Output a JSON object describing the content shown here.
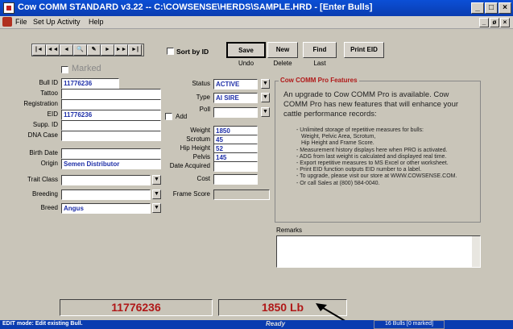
{
  "title": "Cow COMM STANDARD v3.22 -- C:\\COWSENSE\\HERDS\\SAMPLE.HRD - [Enter Bulls]",
  "window_buttons": {
    "minimize": "_",
    "maximize": "□",
    "close": "×"
  },
  "menu": {
    "file": "File",
    "setup": "Set Up",
    "activity": "Activity",
    "help": "Help"
  },
  "mdi_buttons": {
    "minimize": "_",
    "restore": "ø",
    "close": "×"
  },
  "nav": [
    "|◄",
    "◄◄",
    "◄",
    "🔍",
    "✎",
    "►",
    "►►",
    "►|"
  ],
  "sort_by_id": "Sort by ID",
  "buttons": {
    "save": "Save",
    "undo": "Undo",
    "new": "New",
    "delete": "Delete",
    "find": "Find",
    "last": "Last",
    "print_eid": "Print EID"
  },
  "marked": "Marked",
  "labels": {
    "bull_id": "Bull ID",
    "tattoo": "Tattoo",
    "registration": "Registration",
    "eid": "EID",
    "supp_id": "Supp. ID",
    "dna_case": "DNA Case",
    "birth_date": "Birth Date",
    "origin": "Origin",
    "trait_class": "Trait Class",
    "breeding": "Breeding",
    "breed": "Breed",
    "status": "Status",
    "type": "Type",
    "poll": "Poll",
    "add": "Add",
    "weight": "Weight",
    "scrotum": "Scrotum",
    "hip_height": "Hip Height",
    "pelvis": "Pelvis",
    "date_acquired": "Date Acquired",
    "cost": "Cost",
    "frame_score": "Frame Score",
    "remarks": "Remarks"
  },
  "values": {
    "bull_id": "11776236",
    "eid": "11776236",
    "origin": "Semen Distributor",
    "breed": "Angus",
    "status": "ACTIVE",
    "type": "AI SIRE",
    "weight": "1850",
    "scrotum": "45",
    "hip_height": "52",
    "pelvis": "145"
  },
  "pro": {
    "title": "Cow COMM Pro Features",
    "intro": "An upgrade to Cow COMM Pro is available. Cow COMM Pro has new features that will enhance your cattle performance records:",
    "bullets": [
      "- Unlimited storage of repetitive measures for bulls:",
      "  Weight, Pelvic Area, Scrotum,",
      "  Hip Height and Frame Score.",
      "- Measurement history displays here when PRO is activated.",
      "- ADG from last weight is calculated and displayed real time.",
      "- Export repetitive measures to MS Excel or other worksheet.",
      "- Print EID function outputs EID number to a label.",
      "- To upgrade, please visit our store at WWW.COWSENSE.COM.",
      "- Or call Sales at (800) 584-0040."
    ]
  },
  "status": {
    "id_display": "11776236",
    "weight_display": "1850  Lb",
    "mode": "EDIT mode: Edit existing Bull.",
    "ready": "Ready",
    "count": "16 Bulls [0 marked]"
  }
}
